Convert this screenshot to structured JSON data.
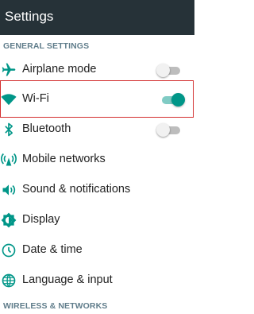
{
  "header": {
    "title": "Settings"
  },
  "sections": {
    "general": "GENERAL SETTINGS",
    "wireless": "WIRELESS & NETWORKS"
  },
  "items": [
    {
      "label": "Airplane mode",
      "icon": "airplane-icon",
      "toggle": false
    },
    {
      "label": "Wi-Fi",
      "icon": "wifi-icon",
      "toggle": true
    },
    {
      "label": "Bluetooth",
      "icon": "bluetooth-icon",
      "toggle": false
    },
    {
      "label": "Mobile networks",
      "icon": "mobile-networks-icon"
    },
    {
      "label": "Sound & notifications",
      "icon": "volume-icon"
    },
    {
      "label": "Display",
      "icon": "display-brightness-icon"
    },
    {
      "label": "Date & time",
      "icon": "clock-icon"
    },
    {
      "label": "Language & input",
      "icon": "globe-icon"
    }
  ],
  "colors": {
    "accent": "#009688",
    "header": "#263238",
    "section": "#607d8b",
    "highlight": "#d32f2f"
  }
}
